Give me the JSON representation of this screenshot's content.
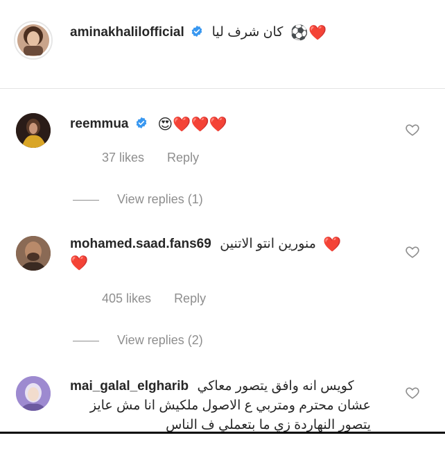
{
  "caption": {
    "username": "aminakhalilofficial",
    "text": "كان شرف ليا",
    "emojis": "⚽❤️"
  },
  "comments": [
    {
      "username": "reemmua",
      "verified": true,
      "text": "",
      "emojis": "😍❤️❤️❤️",
      "likes": "37 likes",
      "reply": "Reply",
      "view_replies": "View replies (1)"
    },
    {
      "username": "mohamed.saad.fans69",
      "verified": false,
      "text": "منورين انتو الاتنين",
      "emojis": "❤️",
      "emojis_line2": "❤️",
      "likes": "405 likes",
      "reply": "Reply",
      "view_replies": "View replies (2)"
    },
    {
      "username": "mai_galal_elgharib",
      "verified": false,
      "line1": "كويس انه وافق يتصور معاكي",
      "line2": "عشان محترم ومتربي ع الاصول ملكيش انا مش عايز",
      "line3": "يتصور النهاردة زي ما بتعملي ف الناس"
    }
  ],
  "colors": {
    "verified": "#3897f0",
    "meta": "#8e8e8e",
    "text": "#262626"
  }
}
